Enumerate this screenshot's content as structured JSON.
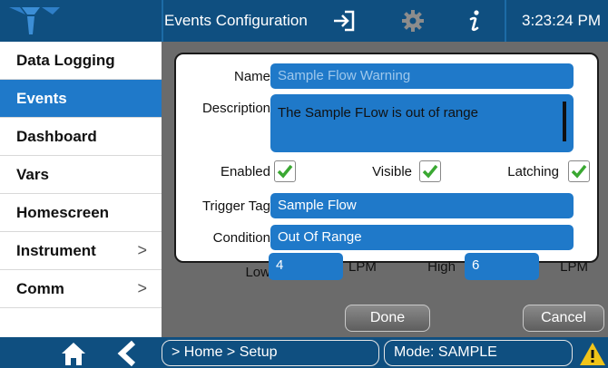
{
  "header": {
    "title": "Events Configuration",
    "time": "3:23:24 PM",
    "icons": [
      "logo-icon",
      "exit-icon",
      "settings-gear-icon",
      "info-icon"
    ]
  },
  "sidebar": {
    "items": [
      {
        "label": "Data Logging",
        "active": false,
        "has_submenu": false
      },
      {
        "label": "Events",
        "active": true,
        "has_submenu": false
      },
      {
        "label": "Dashboard",
        "active": false,
        "has_submenu": false
      },
      {
        "label": "Vars",
        "active": false,
        "has_submenu": false
      },
      {
        "label": "Homescreen",
        "active": false,
        "has_submenu": false
      },
      {
        "label": "Instrument",
        "active": false,
        "has_submenu": true
      },
      {
        "label": "Comm",
        "active": false,
        "has_submenu": true
      }
    ],
    "chevron": ">"
  },
  "form": {
    "name_label": "Name",
    "name_value": "Sample Flow Warning",
    "description_label": "Description",
    "description_value": "The Sample FLow is out of range",
    "enabled_label": "Enabled",
    "enabled": true,
    "visible_label": "Visible",
    "visible": true,
    "latching_label": "Latching",
    "latching": true,
    "trigger_label": "Trigger Tag",
    "trigger_value": "Sample Flow",
    "condition_label": "Condition",
    "condition_value": "Out Of Range",
    "low_label": "Low",
    "low_value": "4",
    "low_unit": "LPM",
    "high_label": "High",
    "high_value": "6",
    "high_unit": "LPM"
  },
  "buttons": {
    "done": "Done",
    "cancel": "Cancel"
  },
  "footer": {
    "breadcrumb": "> Home > Setup",
    "mode": "Mode: SAMPLE",
    "icons": [
      "home-icon",
      "back-icon",
      "warning-icon"
    ]
  },
  "colors": {
    "header_bg": "#0f4f80",
    "accent": "#1f79c9",
    "check": "#3aa832",
    "warning": "#f0c419"
  }
}
